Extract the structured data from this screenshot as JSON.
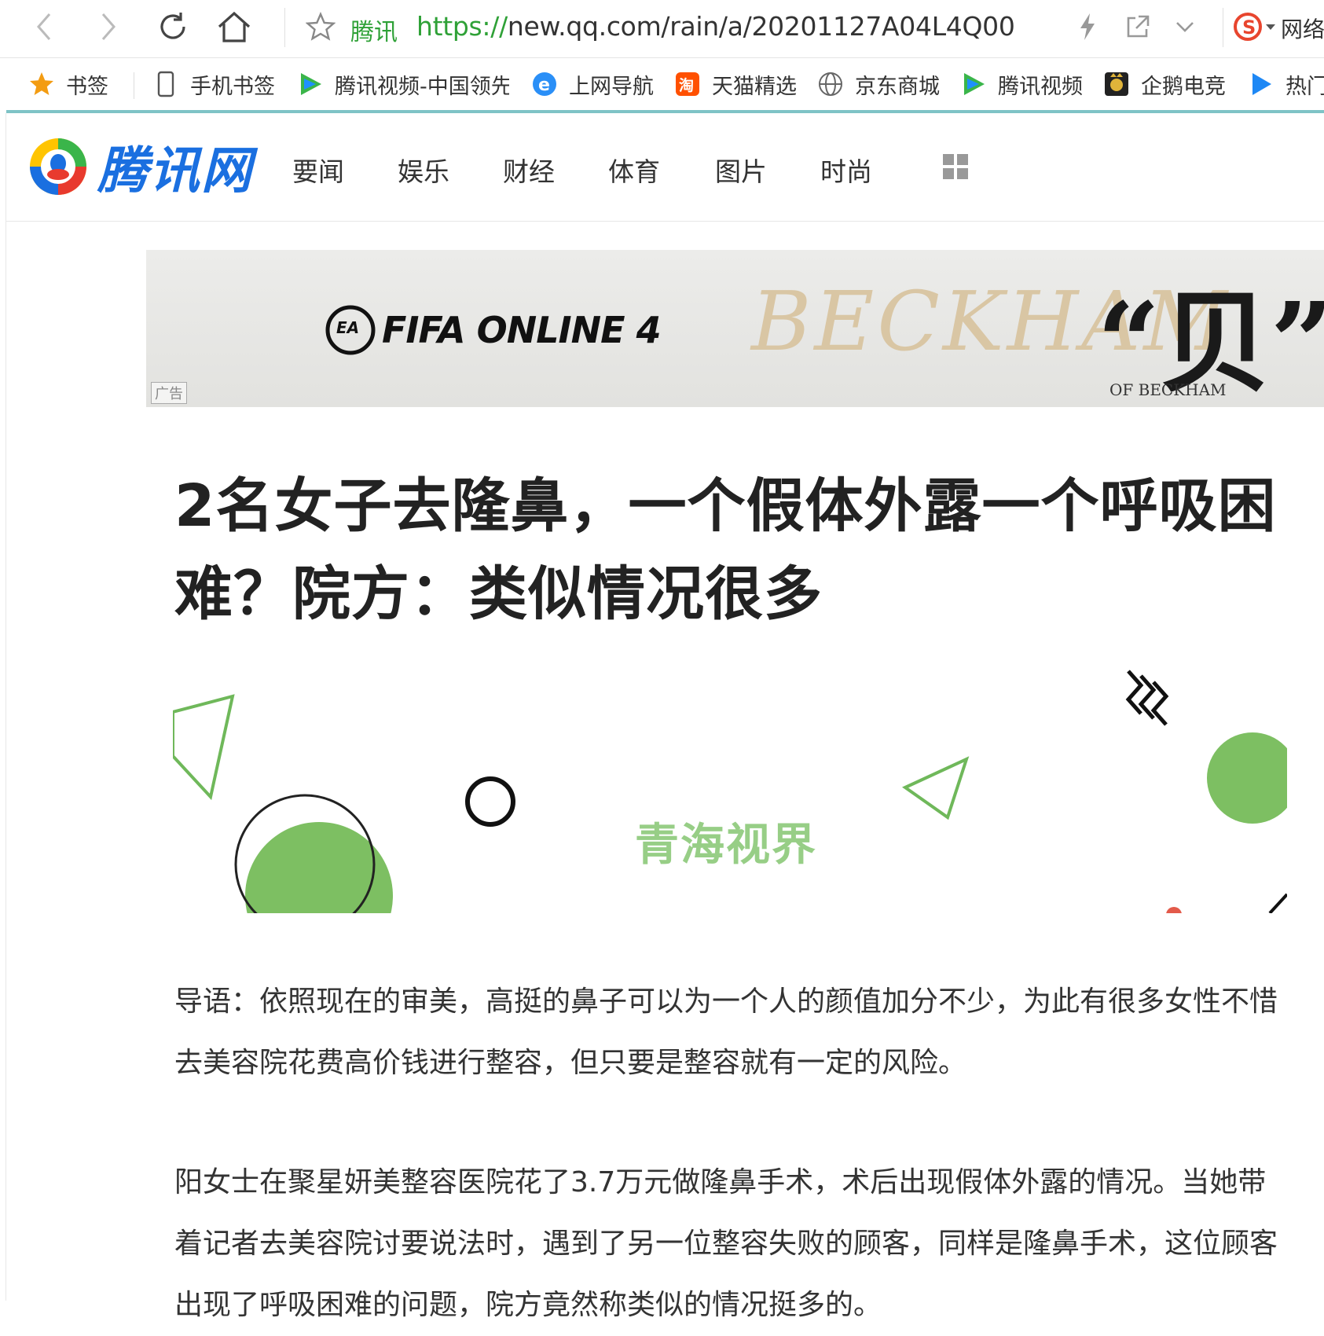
{
  "browser": {
    "site_label": "腾讯",
    "url_protocol": "https://",
    "url_rest": "new.qq.com/rain/a/20201127A04L4Q00",
    "search_extension_label": "网络"
  },
  "bookmarks": [
    {
      "label": "书签",
      "icon": "star-icon"
    },
    {
      "label": "手机书签",
      "icon": "phone-icon"
    },
    {
      "label": "腾讯视频-中国领先",
      "icon": "tencent-video-icon"
    },
    {
      "label": "上网导航",
      "icon": "ie-icon"
    },
    {
      "label": "天猫精选",
      "icon": "taobao-icon"
    },
    {
      "label": "京东商城",
      "icon": "globe-icon"
    },
    {
      "label": "腾讯视频",
      "icon": "tencent-video-icon"
    },
    {
      "label": "企鹅电竞",
      "icon": "esports-icon"
    },
    {
      "label": "热门",
      "icon": "play-icon"
    }
  ],
  "site": {
    "logo_text": "腾讯网",
    "nav": [
      "要闻",
      "娱乐",
      "财经",
      "体育",
      "图片",
      "时尚"
    ]
  },
  "ad": {
    "product": "FIFA ONLINE 4",
    "script_text": "BECKHAM",
    "headline": "“贝”影",
    "subline": "OF BECKHAM",
    "label": "广告"
  },
  "article": {
    "title": "2名女子去隆鼻，一个假体外露一个呼吸困难？院方：类似情况很多",
    "figure_caption": "青海视界",
    "paragraphs": [
      "导语：依照现在的审美，高挺的鼻子可以为一个人的颜值加分不少，为此有很多女性不惜去美容院花费高价钱进行整容，但只要是整容就有一定的风险。",
      "阳女士在聚星妍美整容医院花了3.7万元做隆鼻手术，术后出现假体外露的情况。当她带着记者去美容院讨要说法时，遇到了另一位整容失败的顾客，同样是隆鼻手术，这位顾客出现了呼吸困难的问题，院方竟然称类似的情况挺多的。"
    ]
  },
  "colors": {
    "brand_blue": "#1a6fe0",
    "url_green": "#2fa137",
    "figure_green": "#7dbf62"
  }
}
